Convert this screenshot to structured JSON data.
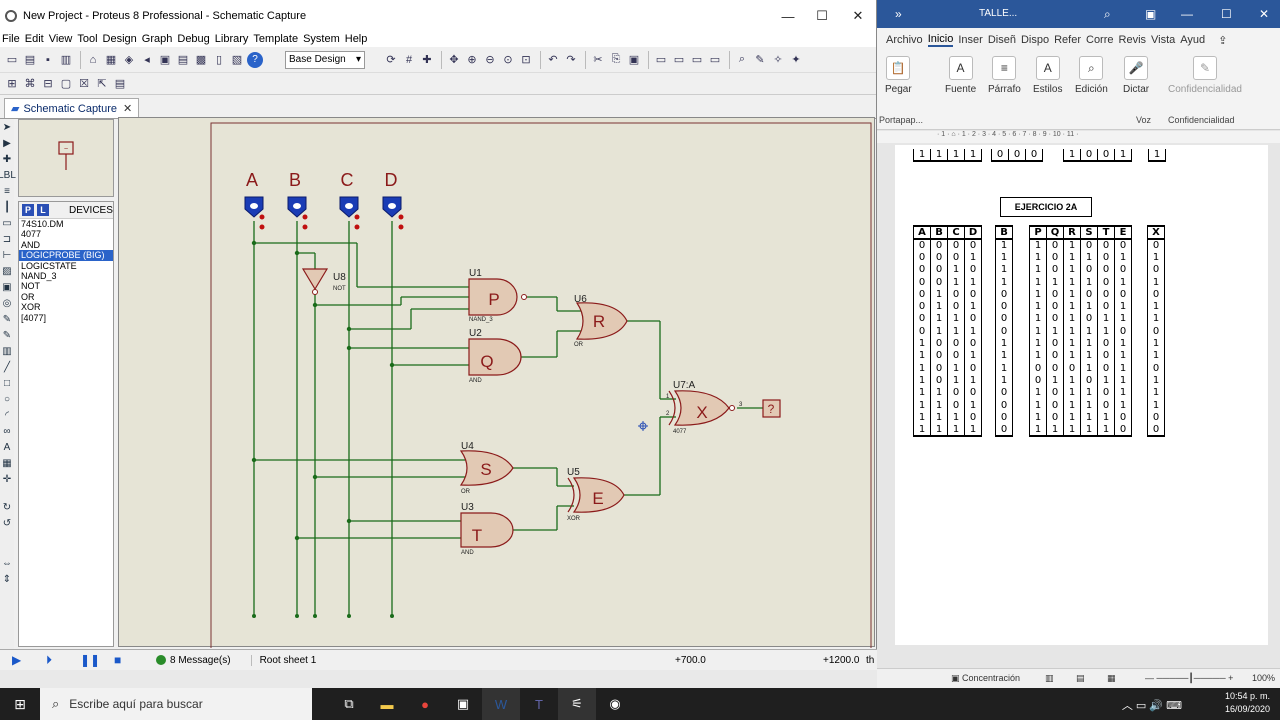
{
  "proteus": {
    "title": "New Project - Proteus 8 Professional - Schematic Capture",
    "menu": [
      "File",
      "Edit",
      "View",
      "Tool",
      "Design",
      "Graph",
      "Debug",
      "Library",
      "Template",
      "System",
      "Help"
    ],
    "design_select": "Base Design",
    "tab_label": "Schematic Capture",
    "devices_header": "DEVICES",
    "devices": [
      "74S10.DM",
      "4077",
      "AND",
      "LOGICPROBE (BIG)",
      "LOGICSTATE",
      "NAND_3",
      "NOT",
      "OR",
      "XOR",
      "[4077]"
    ],
    "selected_device": "LOGICPROBE (BIG)",
    "status": {
      "messages": "8 Message(s)",
      "sheet": "Root sheet 1",
      "coord_x": "+700.0",
      "coord_y": "+1200.0",
      "unit": "th"
    },
    "schematic": {
      "inputs": [
        "A",
        "B",
        "C",
        "D"
      ],
      "gates": {
        "p": {
          "ref": "U1",
          "label": "P",
          "type": "NAND_3"
        },
        "r": {
          "ref": "U6",
          "label": "R",
          "type": "OR"
        },
        "q": {
          "ref": "U2",
          "label": "Q",
          "type": "AND"
        },
        "not": {
          "ref": "U8",
          "type": "NOT"
        },
        "x": {
          "ref": "U7:A",
          "label": "X",
          "type": "4077",
          "pin1": "1",
          "pin2": "2",
          "pin3": "3"
        },
        "s": {
          "ref": "U4",
          "label": "S",
          "type": "OR"
        },
        "e": {
          "ref": "U5",
          "label": "E",
          "type": "XOR"
        },
        "t": {
          "ref": "U3",
          "label": "T",
          "type": "AND"
        }
      },
      "probe_value": "?"
    }
  },
  "word": {
    "title": "TALLE...",
    "tabs": [
      "Archivo",
      "Inicio",
      "Inser",
      "Diseñ",
      "Dispo",
      "Refer",
      "Corre",
      "Revis",
      "Vista",
      "Ayud"
    ],
    "active_tab": "Inicio",
    "ribbon": {
      "pegar": "Pegar",
      "fuente": "Fuente",
      "parrafo": "Párrafo",
      "estilos": "Estilos",
      "edicion": "Edición",
      "dictar": "Dictar",
      "confidencialidad": "Confidencialidad",
      "portapapeles": "Portapap...",
      "voz": "Voz",
      "conf_group": "Confidencialidad"
    },
    "ruler": "· 1 · ⌂ · 1 · 2 · 3 · 4 · 5 · 6 · 7 · 8 · 9 · 10 · 11 ·",
    "exercise_title": "EJERCICIO 2A",
    "prev_rows": [
      [
        "1",
        "1",
        "1",
        "1"
      ]
    ],
    "prev_b": [
      "0",
      "0",
      "0"
    ],
    "prev_c": [
      "1",
      "0",
      "0",
      "1"
    ],
    "prev_x": "1",
    "table_abcd": {
      "header": [
        "A",
        "B",
        "C",
        "D"
      ],
      "rows": [
        [
          "0",
          "0",
          "0",
          "0"
        ],
        [
          "0",
          "0",
          "0",
          "1"
        ],
        [
          "0",
          "0",
          "1",
          "0"
        ],
        [
          "0",
          "0",
          "1",
          "1"
        ],
        [
          "0",
          "1",
          "0",
          "0"
        ],
        [
          "0",
          "1",
          "0",
          "1"
        ],
        [
          "0",
          "1",
          "1",
          "0"
        ],
        [
          "0",
          "1",
          "1",
          "1"
        ],
        [
          "1",
          "0",
          "0",
          "0"
        ],
        [
          "1",
          "0",
          "0",
          "1"
        ],
        [
          "1",
          "0",
          "1",
          "0"
        ],
        [
          "1",
          "0",
          "1",
          "1"
        ],
        [
          "1",
          "1",
          "0",
          "0"
        ],
        [
          "1",
          "1",
          "0",
          "1"
        ],
        [
          "1",
          "1",
          "1",
          "0"
        ],
        [
          "1",
          "1",
          "1",
          "1"
        ]
      ]
    },
    "table_bn": {
      "header": [
        "B̄"
      ],
      "rows": [
        [
          "1"
        ],
        [
          "1"
        ],
        [
          "1"
        ],
        [
          "1"
        ],
        [
          "0"
        ],
        [
          "0"
        ],
        [
          "0"
        ],
        [
          "0"
        ],
        [
          "1"
        ],
        [
          "1"
        ],
        [
          "1"
        ],
        [
          "1"
        ],
        [
          "0"
        ],
        [
          "0"
        ],
        [
          "0"
        ],
        [
          "0"
        ]
      ]
    },
    "table_pqrst": {
      "header": [
        "P",
        "Q",
        "R",
        "S",
        "T",
        "E"
      ],
      "rows": [
        [
          "1",
          "0",
          "1",
          "0",
          "0",
          "0"
        ],
        [
          "1",
          "0",
          "1",
          "1",
          "0",
          "1"
        ],
        [
          "1",
          "0",
          "1",
          "0",
          "0",
          "0"
        ],
        [
          "1",
          "1",
          "1",
          "1",
          "0",
          "1"
        ],
        [
          "1",
          "0",
          "1",
          "0",
          "0",
          "0"
        ],
        [
          "1",
          "0",
          "1",
          "1",
          "0",
          "1"
        ],
        [
          "1",
          "0",
          "1",
          "0",
          "1",
          "1"
        ],
        [
          "1",
          "1",
          "1",
          "1",
          "1",
          "0"
        ],
        [
          "1",
          "0",
          "1",
          "1",
          "0",
          "1"
        ],
        [
          "1",
          "0",
          "1",
          "1",
          "0",
          "1"
        ],
        [
          "0",
          "0",
          "0",
          "1",
          "0",
          "1"
        ],
        [
          "0",
          "1",
          "1",
          "0",
          "1",
          "1"
        ],
        [
          "1",
          "0",
          "1",
          "1",
          "0",
          "1"
        ],
        [
          "1",
          "0",
          "1",
          "1",
          "0",
          "1"
        ],
        [
          "1",
          "0",
          "1",
          "1",
          "1",
          "0"
        ],
        [
          "1",
          "1",
          "1",
          "1",
          "1",
          "0"
        ]
      ]
    },
    "table_x": {
      "header": [
        "X"
      ],
      "rows": [
        [
          "0"
        ],
        [
          "1"
        ],
        [
          "0"
        ],
        [
          "1"
        ],
        [
          "0"
        ],
        [
          "1"
        ],
        [
          "1"
        ],
        [
          "0"
        ],
        [
          "1"
        ],
        [
          "1"
        ],
        [
          "0"
        ],
        [
          "1"
        ],
        [
          "1"
        ],
        [
          "1"
        ],
        [
          "0"
        ],
        [
          "0"
        ]
      ]
    },
    "status": {
      "focus": "Concentración",
      "zoom": "100%"
    }
  },
  "taskbar": {
    "search_placeholder": "Escribe aquí para buscar",
    "time": "10:54 p. m.",
    "date": "16/09/2020"
  }
}
